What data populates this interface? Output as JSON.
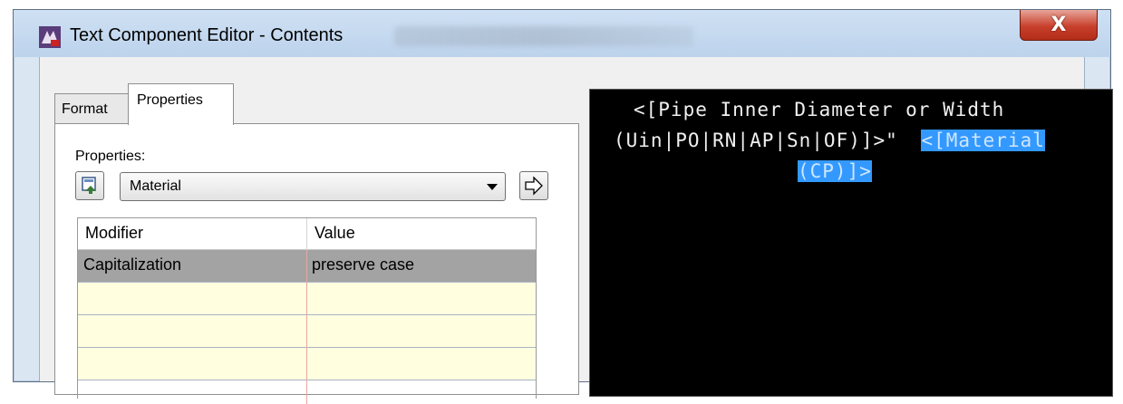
{
  "window": {
    "title": "Text Component Editor - Contents",
    "close_glyph": "X"
  },
  "tabs": [
    {
      "label": "Format"
    },
    {
      "label": "Properties"
    }
  ],
  "properties": {
    "label": "Properties:",
    "selected": "Material"
  },
  "grid": {
    "columns": [
      "Modifier",
      "Value"
    ],
    "rows": [
      {
        "modifier": "Capitalization",
        "value": "preserve case"
      }
    ]
  },
  "preview": {
    "line1": "<[Pipe Inner Diameter or Width",
    "line2_plain": "(Uin|PO|RN|AP|Sn|OF)]>\"",
    "line2_highlight": "<[Material",
    "line3_highlight": "(CP)]>"
  },
  "colors": {
    "selection": "#3399ff",
    "preview_bg": "#000000",
    "selected_row": "#a3a3a3",
    "empty_row": "#ffffe0"
  },
  "icons": [
    "app-icon",
    "close-icon",
    "property-insert-icon",
    "dropdown-arrow-icon",
    "insert-arrow-icon"
  ]
}
